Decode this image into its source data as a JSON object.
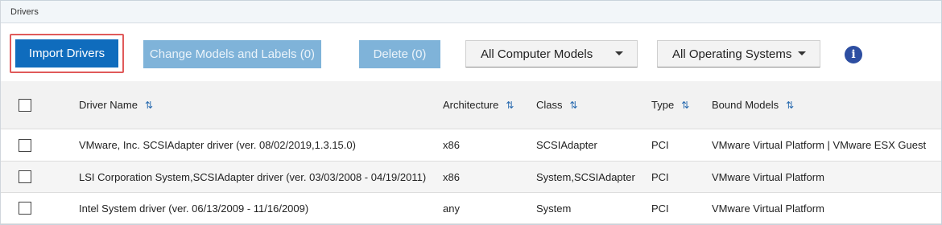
{
  "panel": {
    "title": "Drivers"
  },
  "toolbar": {
    "import_label": "Import Drivers",
    "change_label": "Change Models and Labels (0)",
    "delete_label": "Delete (0)",
    "models_dropdown": "All Computer Models",
    "os_dropdown": "All Operating Systems",
    "info_glyph": "i"
  },
  "table": {
    "columns": [
      "Driver Name",
      "Architecture",
      "Class",
      "Type",
      "Bound Models"
    ],
    "sort_glyph": "⇅",
    "rows": [
      [
        "VMware, Inc. SCSIAdapter driver (ver. 08/02/2019,1.3.15.0)",
        "x86",
        "SCSIAdapter",
        "PCI",
        "VMware Virtual Platform | VMware ESX Guest"
      ],
      [
        "LSI Corporation System,SCSIAdapter driver (ver. 03/03/2008 - 04/19/2011)",
        "x86",
        "System,SCSIAdapter",
        "PCI",
        "VMware Virtual Platform"
      ],
      [
        "Intel System driver (ver. 06/13/2009 - 11/16/2009)",
        "any",
        "System",
        "PCI",
        "VMware Virtual Platform"
      ]
    ]
  },
  "colors": {
    "primary": "#0f6cbd",
    "disabled": "#7fb3d9",
    "highlight": "#e05a5a",
    "info": "#2d4ea1"
  },
  "icons": {
    "info": "info-icon",
    "sort": "sort-icon",
    "caret": "chevron-down-icon"
  }
}
